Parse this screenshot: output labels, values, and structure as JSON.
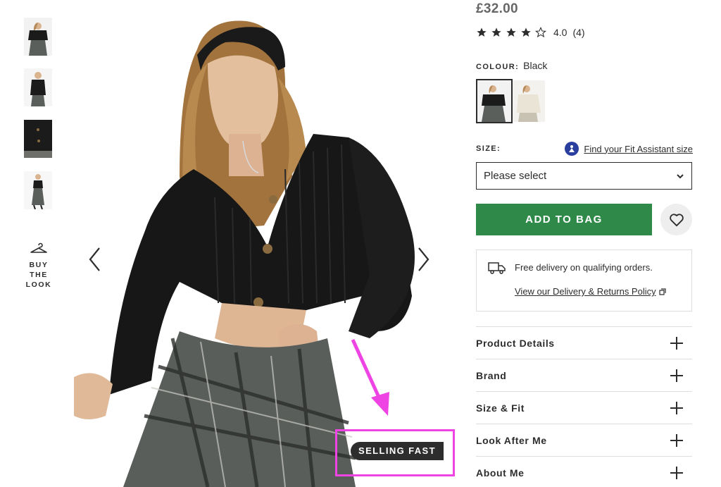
{
  "thumbnails": [
    {
      "alt": "thumb-1"
    },
    {
      "alt": "thumb-2"
    },
    {
      "alt": "thumb-3"
    },
    {
      "alt": "thumb-4"
    }
  ],
  "buy_the_look": {
    "line1": "BUY THE",
    "line2": "LOOK",
    "icon": "hanger-icon"
  },
  "badge": {
    "text": "SELLING FAST"
  },
  "product": {
    "price": "£32.00",
    "rating": {
      "stars": 4,
      "max": 5,
      "value": "4.0",
      "count": "(4)"
    },
    "colour": {
      "label": "COLOUR:",
      "value": "Black"
    },
    "size": {
      "label": "SIZE:",
      "select_placeholder": "Please select",
      "fit_link": "Find your Fit Assistant size"
    },
    "add_to_bag": "ADD TO BAG",
    "delivery": {
      "text": "Free delivery on qualifying orders.",
      "link": "View our Delivery & Returns Policy"
    },
    "accordion": [
      "Product Details",
      "Brand",
      "Size & Fit",
      "Look After Me",
      "About Me"
    ]
  },
  "colors": {
    "accent_green": "#2f8a4a",
    "highlight_pink": "#ee44e4",
    "badge_dark": "#2d2d2d",
    "fit_blue": "#2a3f9d"
  }
}
